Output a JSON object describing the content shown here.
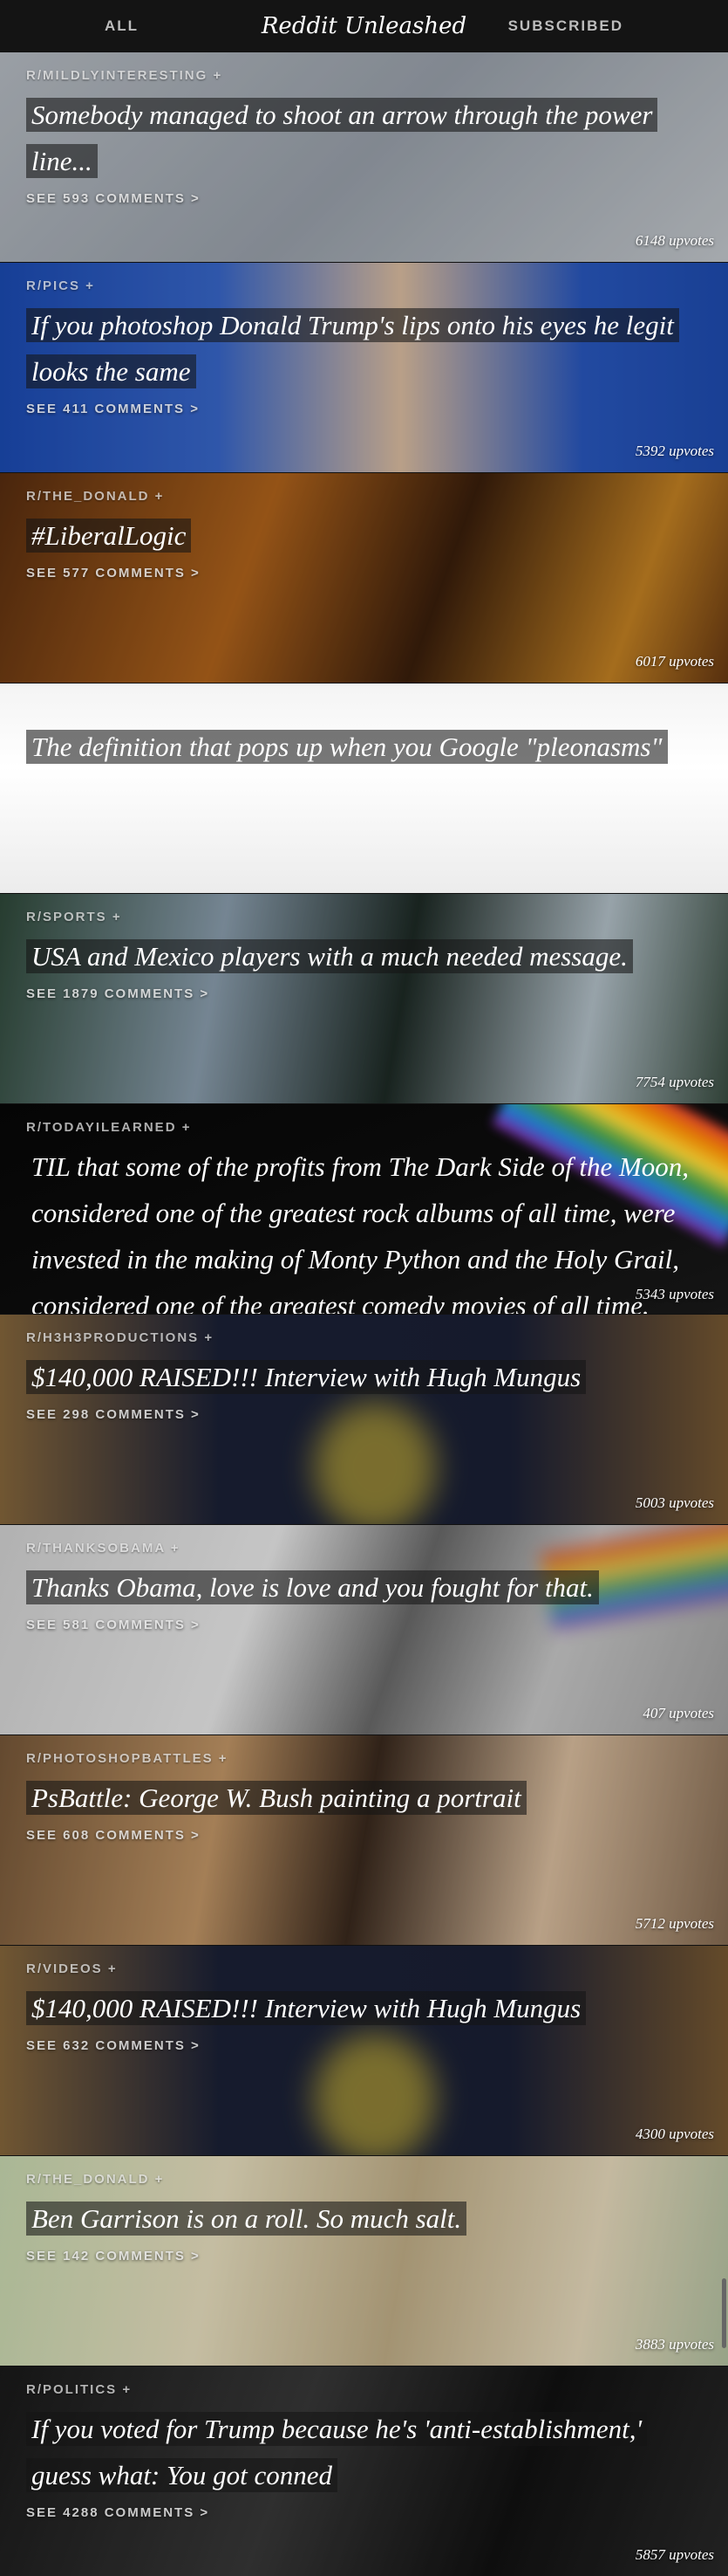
{
  "header": {
    "left_label": "ALL",
    "title": "Reddit Unleashed",
    "right_label": "SUBSCRIBED"
  },
  "posts": [
    {
      "subreddit": "R/MILDLYINTERESTING +",
      "title": "Somebody managed to shoot an arrow through the power line...",
      "comments": "SEE 593 COMMENTS >",
      "upvotes": "6148 upvotes",
      "bg": "linear-gradient(135deg,#bcc2c9,#9ea6b0 50%,#c9ced3)"
    },
    {
      "subreddit": "R/PICS +",
      "title": "If you photoshop Donald Trump's lips onto his eyes he legit looks the same",
      "comments": "SEE 411 COMMENTS >",
      "upvotes": "5392 upvotes",
      "bg": "linear-gradient(90deg,#1c4db8,#3a6ad0 30%,#e2c3a6 55%,#2a5ac4 80%,#1f4eb5)"
    },
    {
      "subreddit": "R/THE_DONALD +",
      "title": "#LiberalLogic",
      "comments": "SEE 577 COMMENTS >",
      "upvotes": "6017 upvotes",
      "bg": "linear-gradient(110deg,#5a2e10,#b5661c 35%,#3b1f0c 60%,#c98524 85%,#6a3a12)"
    },
    {
      "subreddit": "",
      "title": "The definition that pops up when you Google \"pleonasms\"",
      "comments": "",
      "upvotes": "",
      "bg": "linear-gradient(180deg,#f4f4f4,#ffffff 40%,#ececec)"
    },
    {
      "subreddit": "R/SPORTS +",
      "title": "USA and Mexico players with a much needed message.",
      "comments": "SEE 1879 COMMENTS >",
      "upvotes": "7754 upvotes",
      "bg": "linear-gradient(100deg,#2f4a3a,#8fa3b3 30%,#1e2b26 55%,#b9c7cf 80%,#3b4f43)"
    },
    {
      "subreddit": "R/TODAYILEARNED +",
      "title": "TIL that some of the profits from The Dark Side of the Moon, considered one of the greatest rock albums of all time, were invested in the making of Monty Python and the Holy Grail, considered one of the greatest comedy movies of all time.",
      "comments": "",
      "upvotes": "5343 upvotes",
      "bg": "linear-gradient(160deg,#050505,#0b0b0b 55%,#151515)"
    },
    {
      "subreddit": "R/H3H3PRODUCTIONS +",
      "title": "$140,000 RAISED!!! Interview with Hugh Mungus",
      "comments": "SEE 298 COMMENTS >",
      "upvotes": "5003 upvotes",
      "bg": "linear-gradient(90deg,#8a6a3e,#1c2238 30%,#1a2036 70%,#7b5b34)"
    },
    {
      "subreddit": "R/THANKSOBAMA +",
      "title": "Thanks Obama, love is love and you fought for that.",
      "comments": "SEE 581 COMMENTS >",
      "upvotes": "407 upvotes",
      "bg": "linear-gradient(110deg,#d9d9d9,#f1f1f1 35%,#6d6d6d 55%,#cfcfcf 75%,#a8a8a8)"
    },
    {
      "subreddit": "R/PHOTOSHOPBATTLES +",
      "title": "PsBattle: George W. Bush painting a portrait",
      "comments": "SEE 608 COMMENTS >",
      "upvotes": "5712 upvotes",
      "bg": "linear-gradient(100deg,#7a5a3a,#c89b6a 30%,#3b2a1e 50%,#e1c4a4 75%,#8a6f55)"
    },
    {
      "subreddit": "R/VIDEOS +",
      "title": "$140,000 RAISED!!! Interview with Hugh Mungus",
      "comments": "SEE 632 COMMENTS >",
      "upvotes": "4300 upvotes",
      "bg": "linear-gradient(90deg,#8a6a3e,#1c2238 30%,#1a2036 70%,#7b5b34)"
    },
    {
      "subreddit": "R/THE_DONALD +",
      "title": "Ben Garrison is on a roll. So much salt.",
      "comments": "SEE 142 COMMENTS >",
      "upvotes": "3883 upvotes",
      "bg": "linear-gradient(100deg,#cfe0b6,#f0e7c6 30%,#c7b48c 55%,#efe2c3 80%,#b9c7a6)"
    },
    {
      "subreddit": "R/POLITICS +",
      "title": "If you voted for Trump because he's 'anti-establishment,' guess what: You got conned",
      "comments": "SEE 4288 COMMENTS >",
      "upvotes": "5857 upvotes",
      "bg": "linear-gradient(110deg,#1a1a1a,#3a3a3a 40%,#121212 70%,#2a2a2a)"
    }
  ]
}
